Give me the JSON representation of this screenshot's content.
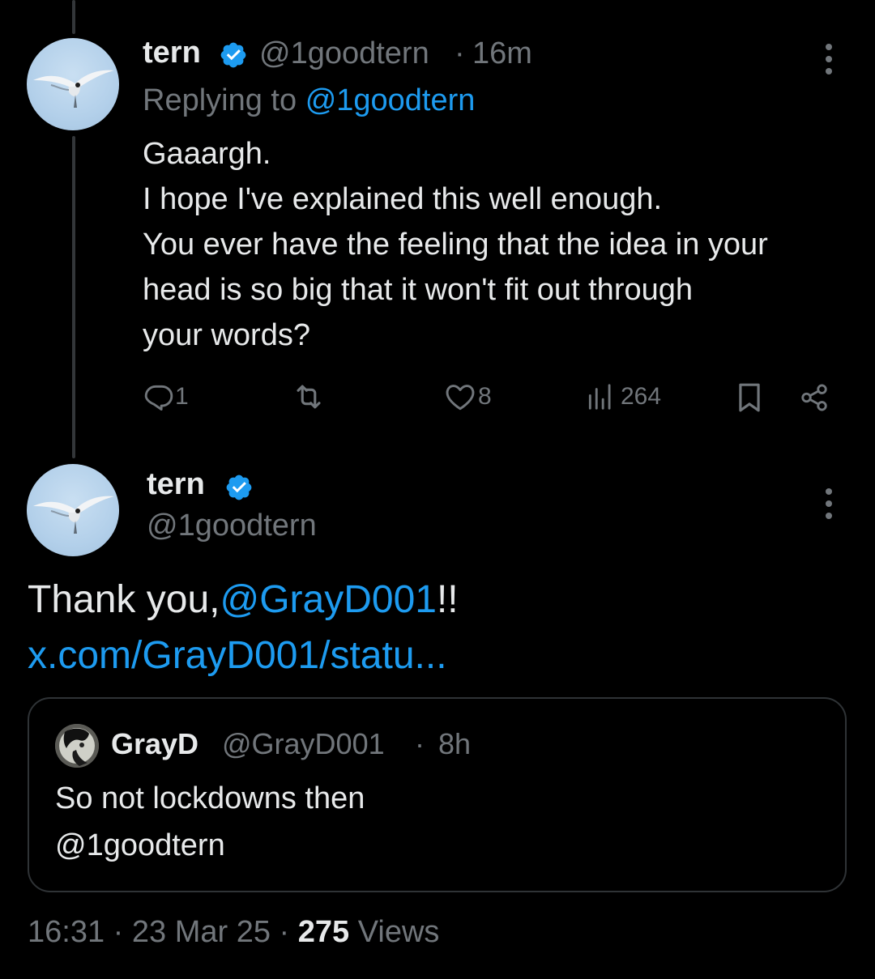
{
  "reply_tweet": {
    "author_name": "tern",
    "author_handle": "@1goodtern",
    "separator": "·",
    "time_ago": "16m",
    "replying_prefix": "Replying to",
    "replying_handle": "@1goodtern",
    "text_lines": [
      "Gaaargh.",
      "I hope I've explained this well enough.",
      "You ever have the feeling that the idea in your",
      "head is so big that it won't fit out through",
      "your words?"
    ],
    "actions": {
      "reply_count": "1",
      "retweet_count": "",
      "like_count": "8",
      "view_count": "264"
    }
  },
  "main_tweet": {
    "author_name": "tern",
    "author_handle": "@1goodtern",
    "text_prefix": "Thank you,",
    "mention": "@GrayD001",
    "text_suffix": "!!",
    "link": "x.com/GrayD001/statu..."
  },
  "quoted_tweet": {
    "author_name": "GrayD",
    "author_handle": "@GrayD001",
    "separator": "·",
    "time_ago": "8h",
    "text_line1": "So not lockdowns then",
    "text_line2": "@1goodtern"
  },
  "meta": {
    "time": "16:31",
    "separator": "·",
    "date": "23 Mar 25",
    "views_count": "275",
    "views_label": "Views"
  },
  "icons": {
    "verified": "verified-badge-icon",
    "more": "more-options-icon",
    "reply": "reply-icon",
    "retweet": "retweet-icon",
    "like": "heart-icon",
    "views": "views-chart-icon",
    "bookmark": "bookmark-icon",
    "share": "share-icon"
  },
  "colors": {
    "background": "#000000",
    "text": "#e7e9ea",
    "muted": "#71767b",
    "accent": "#1d9bf0",
    "border": "#2f3336"
  }
}
